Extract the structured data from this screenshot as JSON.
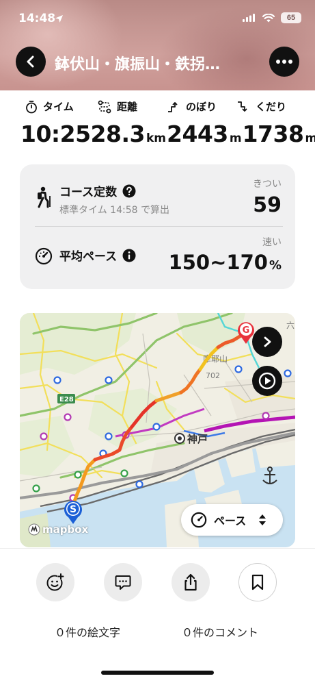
{
  "status": {
    "time": "14:48",
    "battery": "65"
  },
  "header": {
    "title": "鉢伏山・旗振山・鉄拐…"
  },
  "stats": {
    "labels": {
      "time": "タイム",
      "distance": "距離",
      "ascent": "のぼり",
      "descent": "くだり"
    },
    "values": {
      "time": "10:25",
      "distance": "28.3",
      "distance_unit": "km",
      "ascent": "2443",
      "ascent_unit": "m",
      "descent": "1738",
      "descent_unit": "m"
    }
  },
  "card": {
    "course": {
      "title": "コース定数",
      "sub": "標準タイム 14:58 で算出",
      "level": "きつい",
      "value": "59"
    },
    "pace": {
      "title": "平均ペース",
      "level": "速い",
      "value": "150~170",
      "unit": "%"
    }
  },
  "map": {
    "labels": {
      "kobe": "神戸",
      "e28": "E28",
      "elev": "702",
      "mountain": "摩耶山",
      "roku": "六"
    },
    "start_marker": "S",
    "goal_marker": "G",
    "pace_selector": "ペース",
    "attribution": "mapbox"
  },
  "footer": {
    "emoji_count": "０件の絵文字",
    "comment_count": "０件のコメント"
  },
  "colors": {
    "accent": "#e8323c",
    "card_bg": "#f0f0f1",
    "route_fast": "#e8323c",
    "route_slow": "#f2c21e"
  }
}
